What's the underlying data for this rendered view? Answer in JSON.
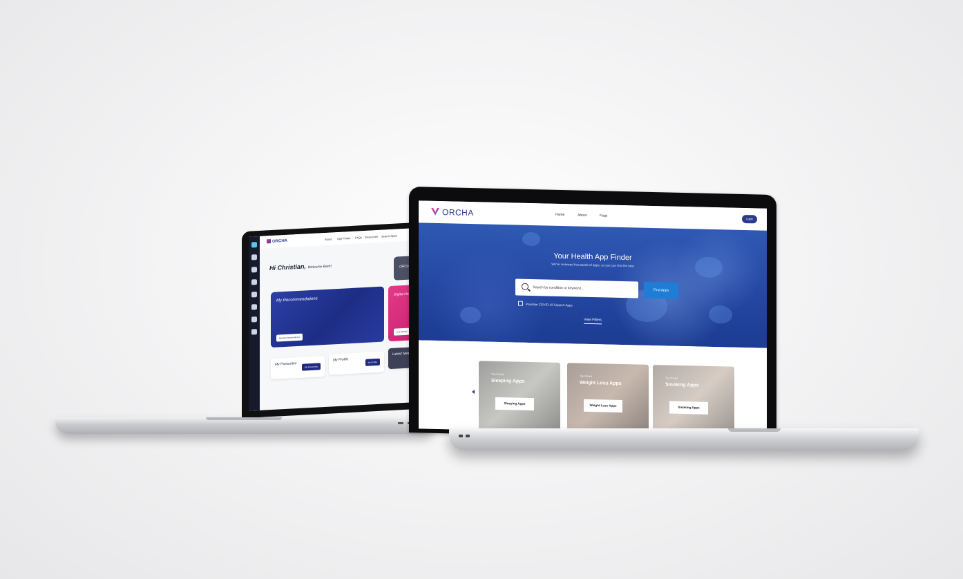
{
  "back_laptop": {
    "nav": {
      "logo": "ORCHA",
      "links": [
        "About",
        "App Finder",
        "FAQs",
        "Resources",
        "Search Apps"
      ]
    },
    "greeting": {
      "name": "Hi Christian,",
      "rest": "Welcome Back!"
    },
    "cards": {
      "orcha_academy": "ORCHA Academy",
      "recommendations": {
        "title": "My Recommendations",
        "button": "My Recommendations"
      },
      "digital_academy": {
        "title": "Digital Health Academy",
        "button": "Get Started"
      },
      "favourites": {
        "title": "My Favourites",
        "button": "My Favourites"
      },
      "profile": {
        "title": "My Profile",
        "button": "My Profile"
      },
      "news": {
        "title": "Latest News",
        "button": "News"
      }
    }
  },
  "front_laptop": {
    "nav": {
      "logo": "ORCHA",
      "links": [
        "Home",
        "About",
        "Faqs"
      ],
      "login": "Login"
    },
    "hero": {
      "title": "Your Health App Finder",
      "subtitle": "We've reviewed thousands of apps, so you can find the best",
      "search_placeholder": "Search by condition or keyword...",
      "find_button": "Find Apps",
      "checkbox_label": "Prioritise COVID-19 Support Apps",
      "view_filters": "View Filters"
    },
    "app_cards": [
      {
        "tag": "Top Rated",
        "title": "Sleeping Apps",
        "button": "Sleeping Apps"
      },
      {
        "tag": "Top Rated",
        "title": "Weight Loss Apps",
        "button": "Weight Loss Apps"
      },
      {
        "tag": "Top Rated",
        "title": "Smoking Apps",
        "button": "Smoking Apps"
      }
    ]
  },
  "colors": {
    "brand_navy": "#2c3990",
    "brand_pink": "#e23b87",
    "hero_blue": "#2447a2",
    "cta_blue": "#1f7dd6"
  }
}
